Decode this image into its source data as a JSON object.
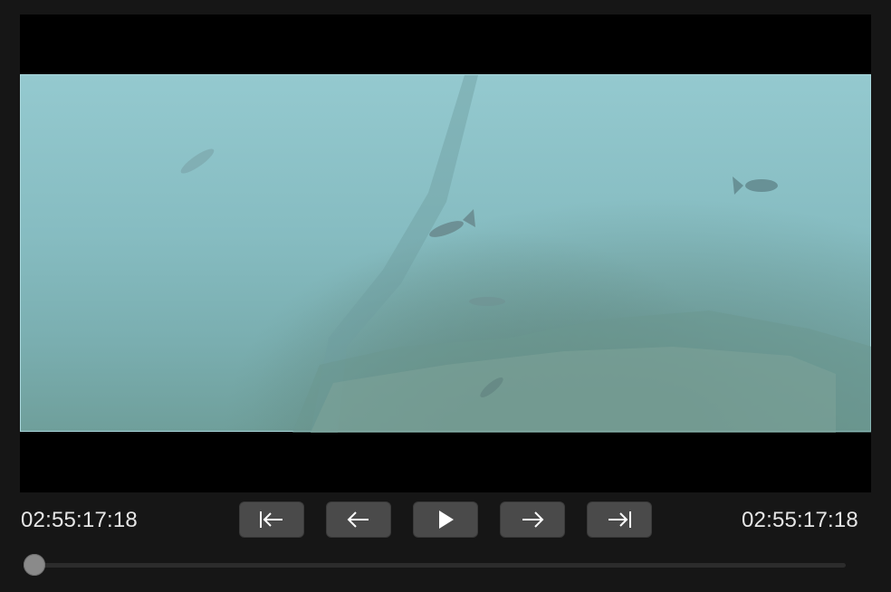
{
  "player": {
    "current_time": "02:55:17:18",
    "end_time": "02:55:17:18",
    "progress": 0.0
  },
  "controls": {
    "items": [
      {
        "name": "go-to-start",
        "icon": "skip-to-start-icon"
      },
      {
        "name": "step-back",
        "icon": "arrow-left-icon"
      },
      {
        "name": "play",
        "icon": "play-icon"
      },
      {
        "name": "step-forward",
        "icon": "arrow-right-icon"
      },
      {
        "name": "go-to-end",
        "icon": "skip-to-end-icon"
      }
    ]
  },
  "colors": {
    "background": "#161616",
    "button": "#4a4a4a",
    "text": "#e6e6e6",
    "water": "#86bcc1"
  }
}
